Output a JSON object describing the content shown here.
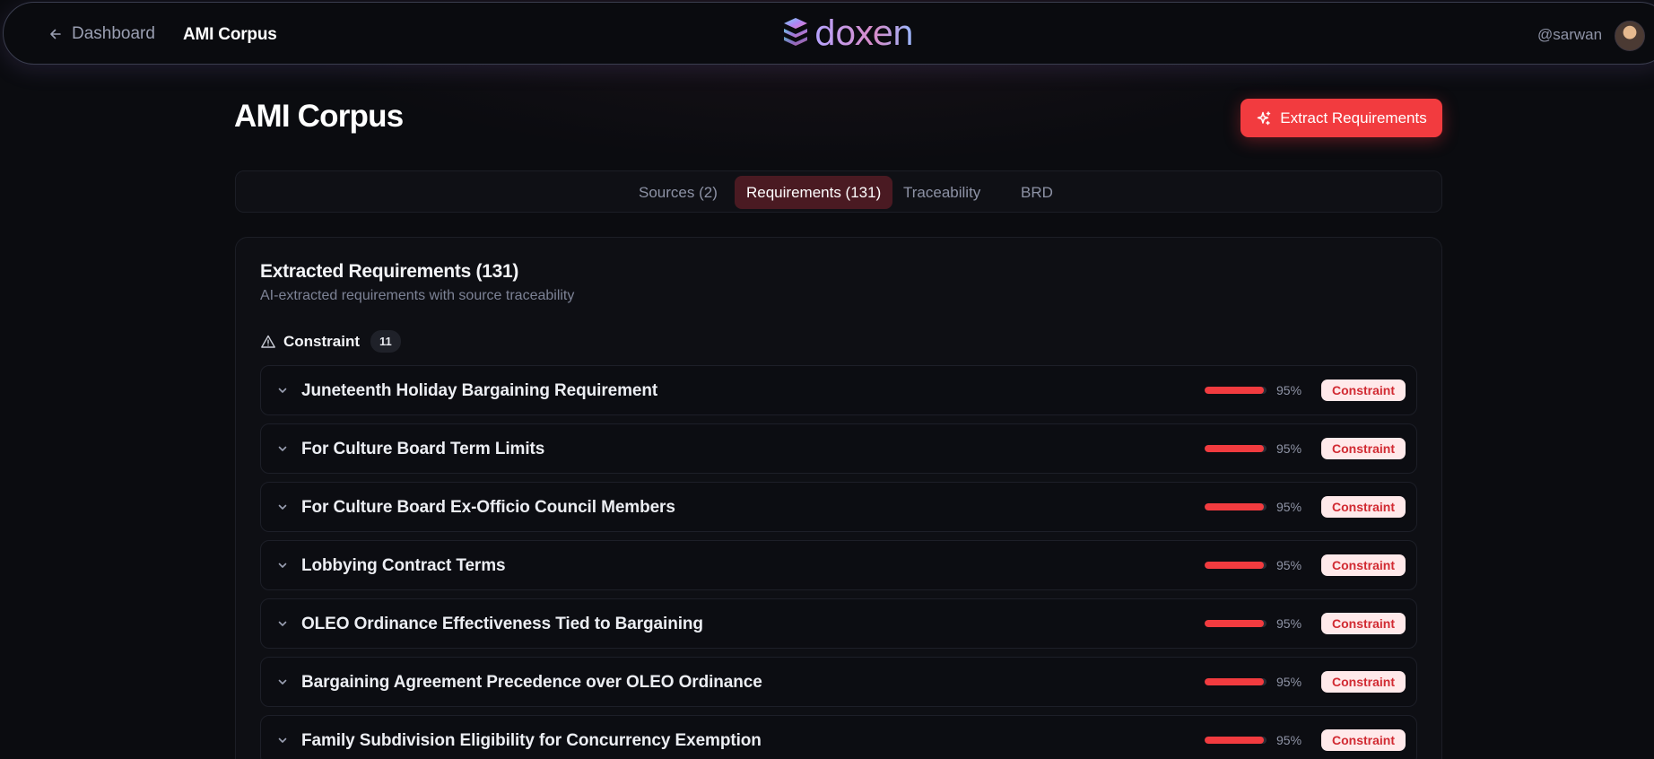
{
  "nav": {
    "back_label": "Dashboard",
    "title": "AMI Corpus",
    "brand": "doxen",
    "handle": "@sarwan"
  },
  "header": {
    "title": "AMI Corpus",
    "extract_label": "Extract Requirements"
  },
  "tabs": [
    {
      "label": "Sources (2)",
      "active": false
    },
    {
      "label": "Requirements (131)",
      "active": true
    },
    {
      "label": "Traceability",
      "active": false
    },
    {
      "label": "BRD",
      "active": false
    }
  ],
  "card": {
    "title": "Extracted Requirements (131)",
    "subtitle": "AI-extracted requirements with source traceability"
  },
  "group": {
    "label": "Constraint",
    "count": "11"
  },
  "requirements": [
    {
      "title": "Juneteenth Holiday Bargaining Requirement",
      "confidence": 0.95,
      "confidence_label": "95%",
      "type": "Constraint"
    },
    {
      "title": "For Culture Board Term Limits",
      "confidence": 0.95,
      "confidence_label": "95%",
      "type": "Constraint"
    },
    {
      "title": "For Culture Board Ex-Officio Council Members",
      "confidence": 0.95,
      "confidence_label": "95%",
      "type": "Constraint"
    },
    {
      "title": "Lobbying Contract Terms",
      "confidence": 0.95,
      "confidence_label": "95%",
      "type": "Constraint"
    },
    {
      "title": "OLEO Ordinance Effectiveness Tied to Bargaining",
      "confidence": 0.95,
      "confidence_label": "95%",
      "type": "Constraint"
    },
    {
      "title": "Bargaining Agreement Precedence over OLEO Ordinance",
      "confidence": 0.95,
      "confidence_label": "95%",
      "type": "Constraint"
    },
    {
      "title": "Family Subdivision Eligibility for Concurrency Exemption",
      "confidence": 0.95,
      "confidence_label": "95%",
      "type": "Constraint"
    }
  ],
  "colors": {
    "accent": "#f23b3f",
    "badge_bg": "#ffe9ea",
    "active_tab_bg": "#4a1a22"
  }
}
